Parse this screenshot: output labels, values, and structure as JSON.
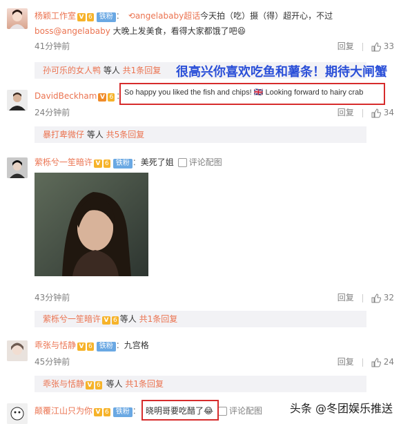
{
  "c1": {
    "user": "杨颖工作室",
    "mention": "angelababy超话",
    "text_a": "今天拍（吃）摄（得）超开心，不过",
    "mention2": "boss@angelababy",
    "text_b": " 大晚上发美食，看得大家都饿了吧",
    "time": "41分钟前",
    "reply": "回复",
    "likes": "33",
    "fan_badge": "铁粉",
    "emoji": "😆"
  },
  "r1": {
    "user": "孙可乐的女人鸭",
    "suffix": " 等人 ",
    "count": "共1条回复"
  },
  "translation": "很高兴你喜欢吃鱼和薯条！期待大闸蟹",
  "c2": {
    "user": "DavidBeckham",
    "text": "So happy you liked the fish and chips! 🇬🇧 Looking forward to hairy crab",
    "time": "24分钟前",
    "reply": "回复",
    "likes": "34"
  },
  "r2": {
    "user": "暴打卑微仔",
    "suffix": " 等人 ",
    "count": "共5条回复"
  },
  "c3": {
    "user": "萦栎兮一笙暗许",
    "fan_badge": "铁粉",
    "text": "美死了姐",
    "pic": "评论配图",
    "time": "43分钟前",
    "reply": "回复",
    "likes": "32"
  },
  "r3": {
    "user": "萦栎兮一笙暗许",
    "suffix": "等人 ",
    "count": "共1条回复"
  },
  "c4": {
    "user": "乖张与恬静",
    "fan_badge": "铁粉",
    "text": "九宫格",
    "time": "45分钟前",
    "reply": "回复",
    "likes": "24"
  },
  "r4": {
    "user": "乖张与恬静",
    "suffix": " 等人 ",
    "count": "共1条回复"
  },
  "c5": {
    "user": "颠覆江山只为你",
    "fan_badge": "铁粉",
    "text": "晓明哥要吃醋了",
    "emoji": "😂",
    "pic": "评论配图"
  },
  "watermark": "头条 @冬团娱乐推送",
  "colors": {
    "link": "#eb7350",
    "highlight": "#d62b2b",
    "translation": "#2a4fd8",
    "fan_badge": "#6aa8e3"
  }
}
